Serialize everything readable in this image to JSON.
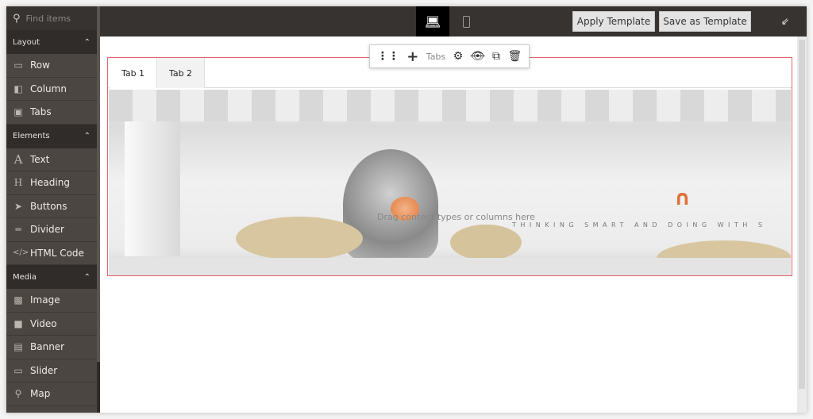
{
  "sidebar": {
    "search_placeholder": "Find items",
    "groups": [
      {
        "label": "Layout",
        "items": [
          {
            "label": "Row",
            "icon": "row-icon"
          },
          {
            "label": "Column",
            "icon": "column-icon"
          },
          {
            "label": "Tabs",
            "icon": "tabs-icon"
          }
        ]
      },
      {
        "label": "Elements",
        "items": [
          {
            "label": "Text",
            "icon": "text-icon"
          },
          {
            "label": "Heading",
            "icon": "heading-icon"
          },
          {
            "label": "Buttons",
            "icon": "cursor-icon"
          },
          {
            "label": "Divider",
            "icon": "divider-icon"
          },
          {
            "label": "HTML Code",
            "icon": "code-icon"
          }
        ]
      },
      {
        "label": "Media",
        "items": [
          {
            "label": "Image",
            "icon": "image-icon"
          },
          {
            "label": "Video",
            "icon": "video-icon"
          },
          {
            "label": "Banner",
            "icon": "banner-icon"
          },
          {
            "label": "Slider",
            "icon": "slider-icon"
          },
          {
            "label": "Map",
            "icon": "map-icon"
          }
        ]
      }
    ]
  },
  "topbar": {
    "apply_template": "Apply Template",
    "save_template": "Save as Template",
    "active_device": "desktop"
  },
  "toolbar": {
    "label": "Tabs"
  },
  "tabs": [
    {
      "label": "Tab 1",
      "active": true
    },
    {
      "label": "Tab 2",
      "active": false
    }
  ],
  "banner": {
    "tagline": "THINKING SMART AND DOING WITH S",
    "placeholder": "Drag content types or columns here"
  },
  "colors": {
    "selection_border": "#e0636a",
    "sidebar": "#4b4642",
    "topbar": "#373330"
  }
}
